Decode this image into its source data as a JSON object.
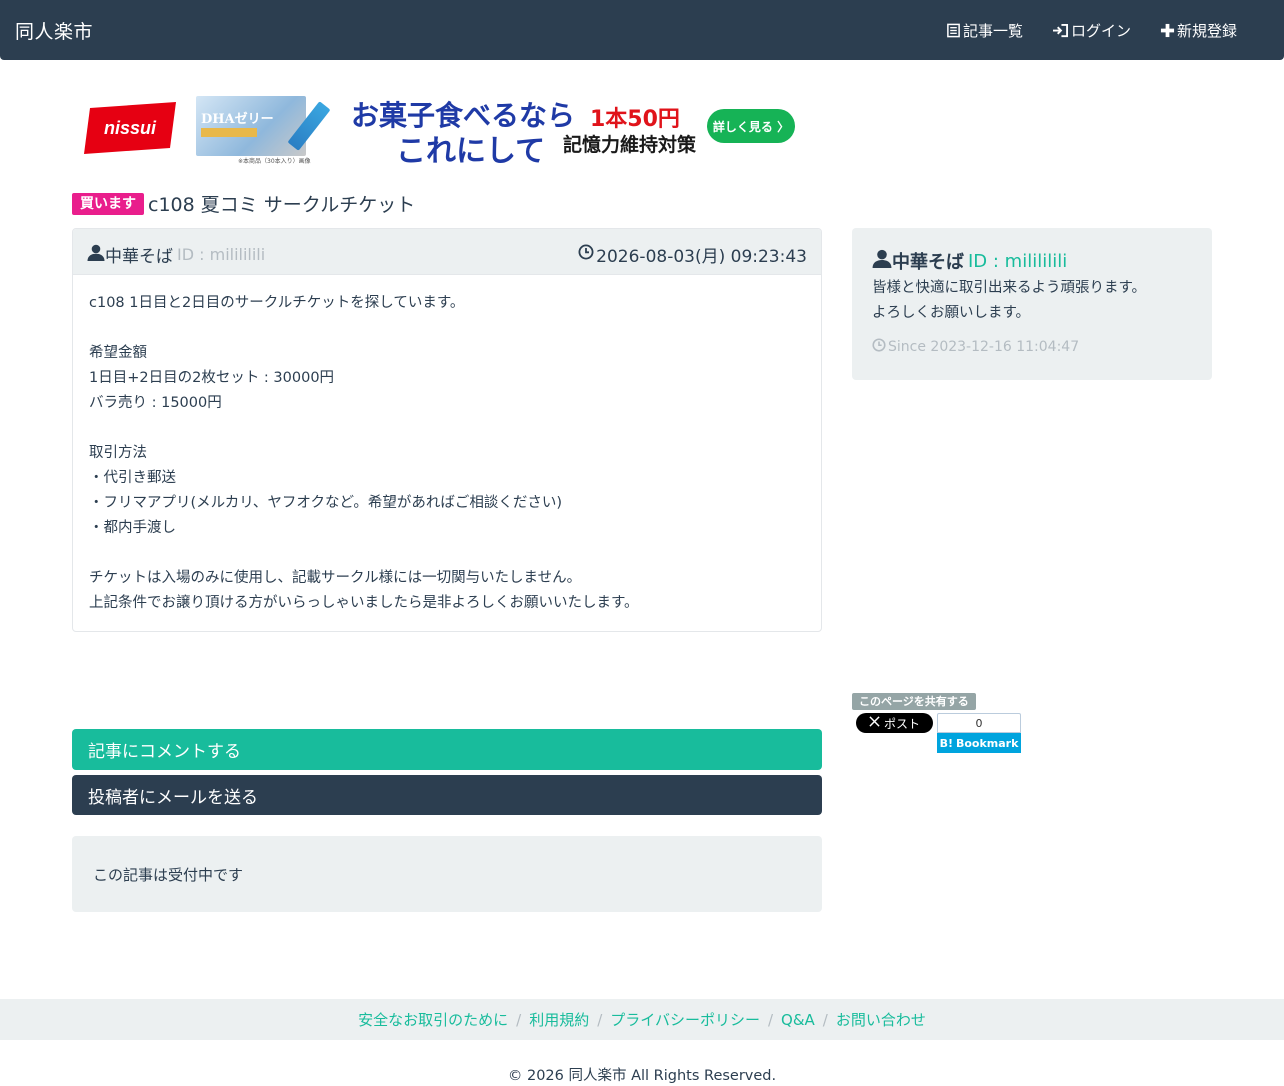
{
  "nav": {
    "brand": "同人楽市",
    "articles": "記事一覧",
    "login": "ログイン",
    "register": "新規登録"
  },
  "ad": {
    "logo": "nissui",
    "product_name": "DHAゼリー",
    "note": "※本商品（30本入り）画像",
    "headline1": "お菓子食べるなら",
    "headline2": "これにして",
    "price": "1本50円",
    "sub": "記憶力維持対策",
    "button": "詳しく見る 〉"
  },
  "post": {
    "badge": "買います",
    "title": "c108 夏コミ サークルチケット",
    "author": "中華そば",
    "author_id": "ID : milililili",
    "date": "2026-08-03(月) 09:23:43",
    "body": [
      "c108 1日目と2日目のサークルチケットを探しています。",
      "",
      "希望金額",
      "1日目+2日目の2枚セット : 30000円",
      "バラ売り : 15000円",
      "",
      "取引方法",
      "・代引き郵送",
      "・フリマアプリ(メルカリ、ヤフオクなど。希望があればご相談ください)",
      "・都内手渡し",
      "",
      "チケットは入場のみに使用し、記載サークル様には一切関与いたしません。",
      "上記条件でお譲り頂ける方がいらっしゃいましたら是非よろしくお願いいたします。"
    ]
  },
  "profile": {
    "name": "中華そば",
    "id": "ID : milililili",
    "bio1": "皆様と快適に取引出来るよう頑張ります。",
    "bio2": "よろしくお願いします。",
    "since": "Since 2023-12-16 11:04:47"
  },
  "share": {
    "label": "このページを共有する",
    "x_post": "ポスト",
    "hb_count": "0",
    "hb_label": "Bookmark"
  },
  "actions": {
    "comment": "記事にコメントする",
    "mail": "投稿者にメールを送る",
    "status": "この記事は受付中です"
  },
  "footer": {
    "links": [
      "安全なお取引のために",
      "利用規約",
      "プライバシーポリシー",
      "Q&A",
      "お問い合わせ"
    ],
    "copyright": "© 2026 同人楽市 All Rights Reserved."
  },
  "colors": {
    "navbar": "#2c3e50",
    "accent": "#18bc9c",
    "badge": "#e91e8c",
    "panel": "#ecf0f1"
  }
}
